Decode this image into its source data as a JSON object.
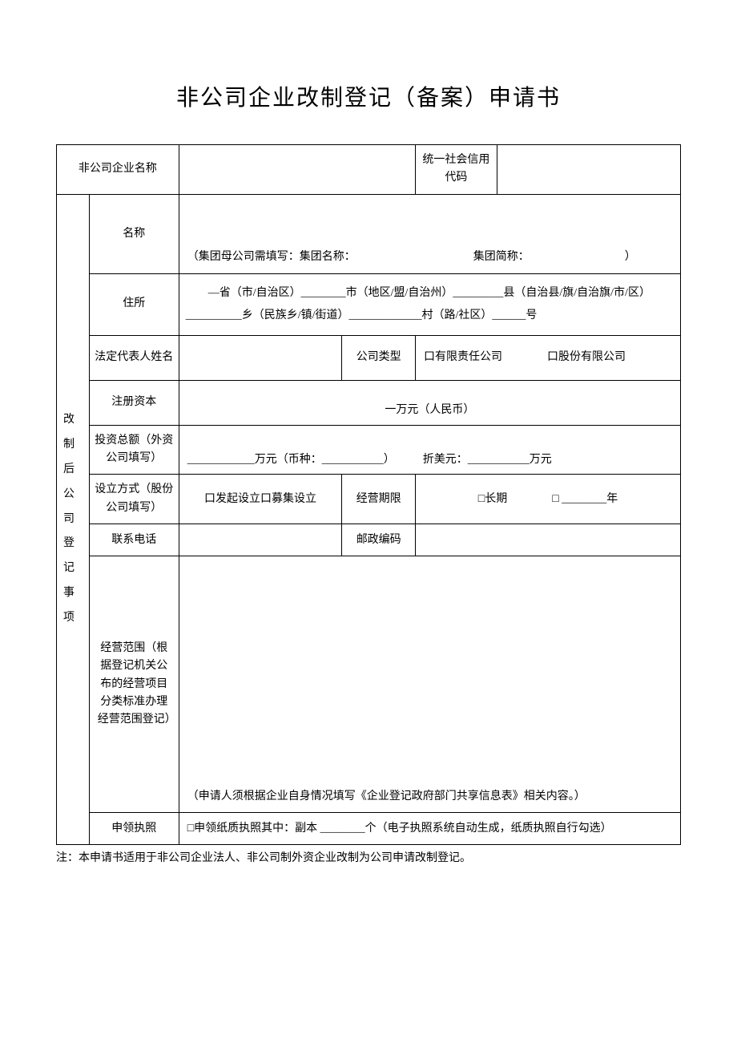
{
  "title": "非公司企业改制登记（备案）申请书",
  "header": {
    "company_name_label": "非公司企业名称",
    "credit_code_label": "统一社会信用代码"
  },
  "section_label": "改制后公司登记事项",
  "rows": {
    "name_label": "名称",
    "group_hint": "（集团母公司需填写：集团名称：　　　　　　　　　　　集团简称：　　　　　　　　　）",
    "address_label": "住所",
    "address_template": "　　—省（市/自治区）________市（地区/盟/自治州）_________县（自治县/旗/自治旗/市/区）__________乡（民族乡/镇/街道）_____________村（路/社区）______号",
    "legal_rep_label": "法定代表人姓名",
    "company_type_label": "公司类型",
    "company_type_options": "口有限责任公司　　　　口股份有限公司",
    "reg_capital_label": "注册资本",
    "reg_capital_value": "一万元（人民币）",
    "total_invest_label": "投资总额（外资公司填写）",
    "total_invest_value": "____________万元（币种：___________）　　　折美元：___________万元",
    "establish_label": "设立方式（股份公司填写）",
    "establish_value": "口发起设立口募集设立",
    "term_label": "经营期限",
    "term_value": "□长期　　　　□ ________年",
    "phone_label": "联系电话",
    "postal_label": "邮政编码",
    "scope_label": "经营范围（根据登记机关公布的经营项目分类标准办理经营范围登记）",
    "scope_hint": "（申请人须根据企业自身情况填写《企业登记政府部门共享信息表》相关内容。）",
    "license_label": "申领执照",
    "license_value": "□申领纸质执照其中：副本 ________个（电子执照系统自动生成，纸质执照自行勾选）"
  },
  "footer_note": "注：本申请书适用于非公司企业法人、非公司制外资企业改制为公司申请改制登记。"
}
